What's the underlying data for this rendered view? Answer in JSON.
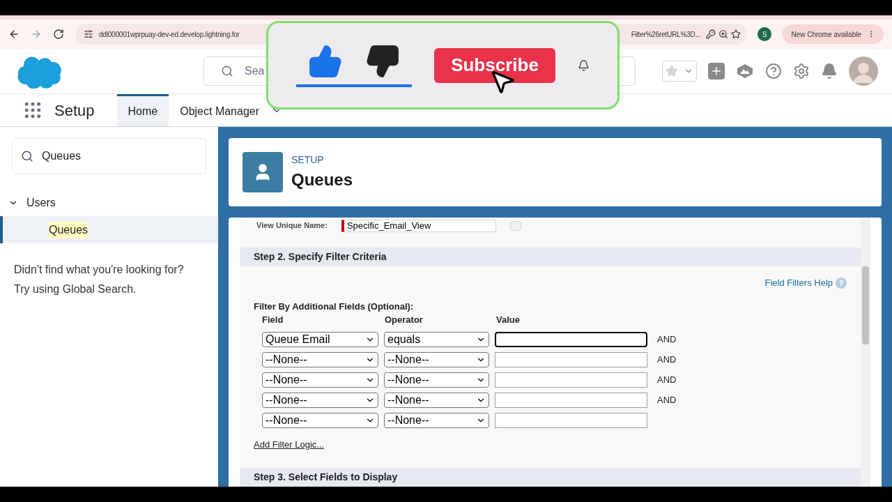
{
  "browser": {
    "url_start": "ddl000001wprpuay-dev-ed.develop.lightning.for",
    "url_end": "Filter%26retURL%3D...",
    "profile_initial": "S",
    "update_button": "New Chrome available"
  },
  "header": {
    "search_placeholder": "Sea"
  },
  "nav": {
    "app_name": "Setup",
    "tabs": [
      {
        "label": "Home",
        "selected": true
      },
      {
        "label": "Object Manager",
        "selected": false
      }
    ]
  },
  "sidebar": {
    "search_value": "Queues",
    "tree": [
      {
        "label": "Users",
        "expanded": true,
        "selected": false,
        "children": [
          {
            "label": "Queues",
            "selected": true
          }
        ]
      }
    ],
    "hint_lines": [
      "Didn't find what you're looking for?",
      "Try using Global Search."
    ]
  },
  "page_header": {
    "eyebrow": "SETUP",
    "title": "Queues"
  },
  "form": {
    "unique_name_label": "View Unique Name:",
    "unique_name_value": "Specific_Email_View",
    "step2_title": "Step 2. Specify Filter Criteria",
    "help_link": "Field Filters Help",
    "help_icon": "?",
    "filter_heading": "Filter By Additional Fields (Optional):",
    "columns": [
      "Field",
      "Operator",
      "Value"
    ],
    "rows": [
      {
        "field": "Queue Email",
        "operator": "equals",
        "focused": true,
        "connector": "AND"
      },
      {
        "field": "--None--",
        "operator": "--None--",
        "focused": false,
        "connector": "AND"
      },
      {
        "field": "--None--",
        "operator": "--None--",
        "focused": false,
        "connector": "AND"
      },
      {
        "field": "--None--",
        "operator": "--None--",
        "focused": false,
        "connector": "AND"
      },
      {
        "field": "--None--",
        "operator": "--None--",
        "focused": false
      }
    ],
    "add_logic_link": "Add Filter Logic...",
    "step3_title": "Step 3. Select Fields to Display"
  },
  "overlay": {
    "subscribe": "Subscribe"
  }
}
